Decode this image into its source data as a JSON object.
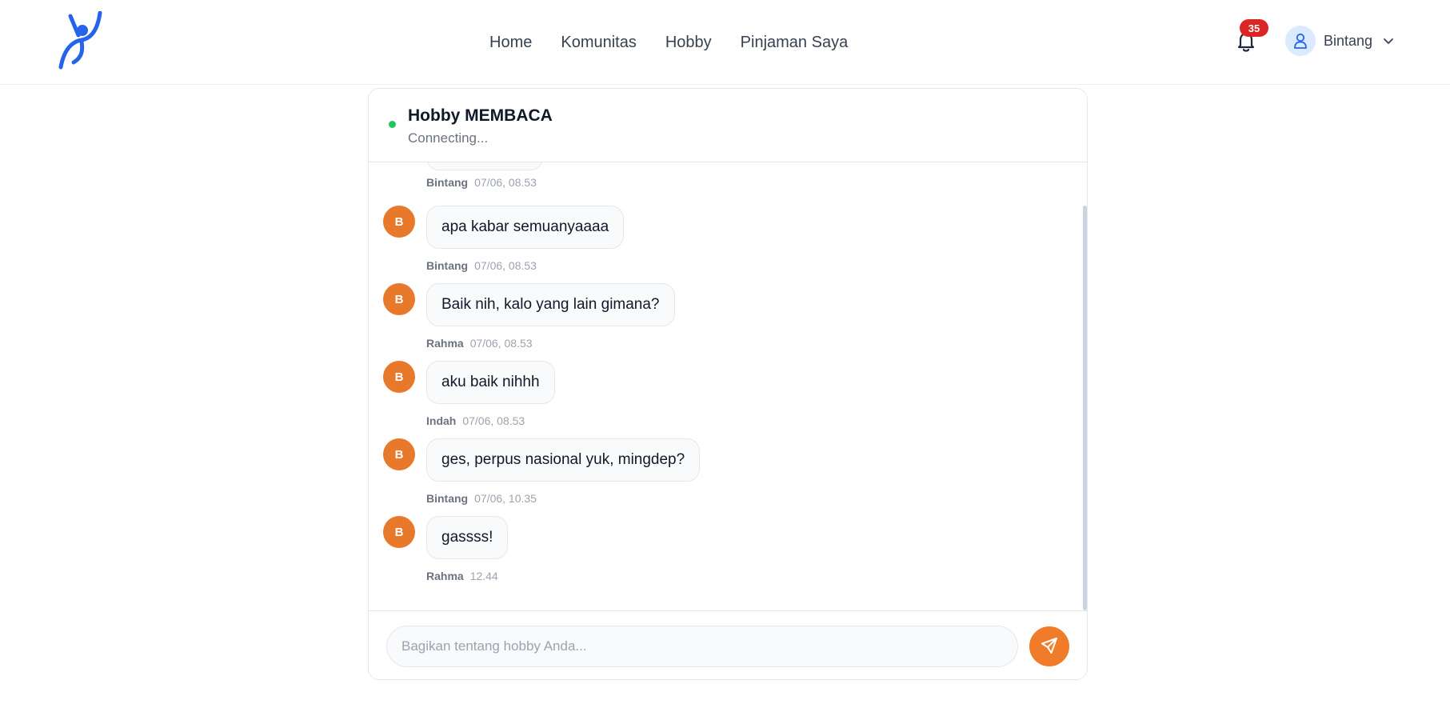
{
  "header": {
    "nav": [
      "Home",
      "Komunitas",
      "Hobby",
      "Pinjaman Saya"
    ],
    "notification_count": "35",
    "user_name": "Bintang"
  },
  "chat": {
    "title": "Hobby MEMBACA",
    "status": "Connecting...",
    "partial_message": {
      "sender": "Bintang",
      "time": "07/06, 08.53"
    },
    "messages": [
      {
        "avatar": "B",
        "text": "apa kabar semuanyaaaa",
        "sender": "Bintang",
        "time": "07/06, 08.53"
      },
      {
        "avatar": "B",
        "text": "Baik nih, kalo yang lain gimana?",
        "sender": "Rahma",
        "time": "07/06, 08.53"
      },
      {
        "avatar": "B",
        "text": "aku baik nihhh",
        "sender": "Indah",
        "time": "07/06, 08.53"
      },
      {
        "avatar": "B",
        "text": "ges, perpus nasional yuk, mingdep?",
        "sender": "Bintang",
        "time": "07/06, 10.35"
      },
      {
        "avatar": "B",
        "text": "gassss!",
        "sender": "Rahma",
        "time": "12.44"
      }
    ],
    "input_placeholder": "Bagikan tentang hobby Anda..."
  },
  "colors": {
    "brand_blue": "#2563eb",
    "accent_orange": "#f07c2a",
    "avatar_orange": "#e8782a",
    "online_green": "#22c55e",
    "badge_red": "#dc2626"
  },
  "icons": [
    "logo-icon",
    "bell-icon",
    "user-icon",
    "chevron-down-icon",
    "send-icon"
  ]
}
